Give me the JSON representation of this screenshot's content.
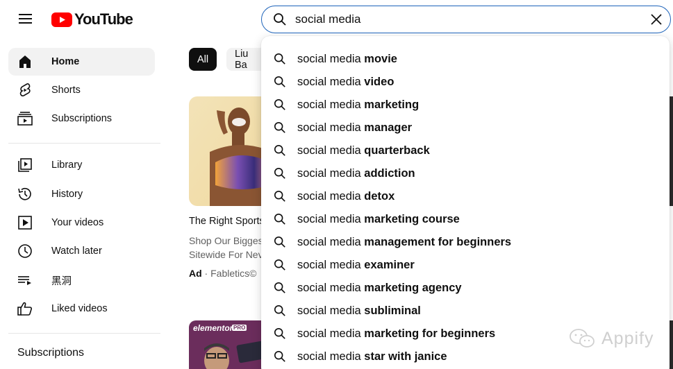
{
  "header": {
    "logo_text": "YouTube",
    "search_value": "social media"
  },
  "sidebar": {
    "items": [
      {
        "label": "Home",
        "icon": "home-icon",
        "active": true
      },
      {
        "label": "Shorts",
        "icon": "shorts-icon"
      },
      {
        "label": "Subscriptions",
        "icon": "subscriptions-icon"
      },
      {
        "label": "Library",
        "icon": "library-icon"
      },
      {
        "label": "History",
        "icon": "history-icon"
      },
      {
        "label": "Your videos",
        "icon": "your-videos-icon"
      },
      {
        "label": "Watch later",
        "icon": "watch-later-icon"
      },
      {
        "label": "黑洞",
        "icon": "playlist-icon"
      },
      {
        "label": "Liked videos",
        "icon": "thumbs-up-icon"
      }
    ],
    "subscriptions_title": "Subscriptions"
  },
  "chips": [
    {
      "label": "All",
      "active": true
    },
    {
      "label": "Liu Ba",
      "active": false
    }
  ],
  "video_card": {
    "title": "The Right Sports",
    "desc_line1": "Shop Our Bigges",
    "desc_line2": "Sitewide For Nev",
    "ad_label": "Ad",
    "ad_sep": " · ",
    "advertiser": "Fabletics©",
    "thumb2_label": "elementor",
    "thumb2_badge": "PRO"
  },
  "suggestions": [
    {
      "prefix": "social media ",
      "completion": "movie"
    },
    {
      "prefix": "social media ",
      "completion": "video"
    },
    {
      "prefix": "social media ",
      "completion": "marketing"
    },
    {
      "prefix": "social media ",
      "completion": "manager"
    },
    {
      "prefix": "social media ",
      "completion": "quarterback"
    },
    {
      "prefix": "social media ",
      "completion": "addiction"
    },
    {
      "prefix": "social media ",
      "completion": "detox"
    },
    {
      "prefix": "social media ",
      "completion": "marketing course"
    },
    {
      "prefix": "social media ",
      "completion": "management for beginners"
    },
    {
      "prefix": "social media ",
      "completion": "examiner"
    },
    {
      "prefix": "social media ",
      "completion": "marketing agency"
    },
    {
      "prefix": "social media ",
      "completion": "subliminal"
    },
    {
      "prefix": "social media ",
      "completion": "marketing for beginners"
    },
    {
      "prefix": "social media ",
      "completion": "star with janice"
    }
  ],
  "watermark": {
    "text": "Appify"
  },
  "colors": {
    "brand_red": "#ff0000",
    "focus_blue": "#1c62b9",
    "text": "#0f0f0f",
    "secondary_text": "#606060"
  }
}
